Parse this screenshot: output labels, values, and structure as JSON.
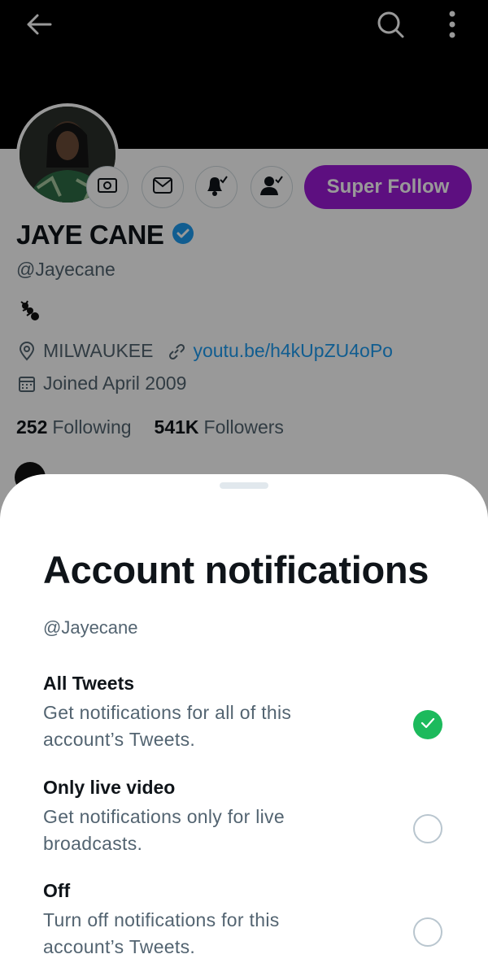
{
  "profile": {
    "super_follow_label": "Super Follow",
    "display_name": "JAYE CANE",
    "handle": "@Jayecane",
    "location": "MILWAUKEE",
    "link": "youtu.be/h4kUpZU4oPo",
    "joined": "Joined April 2009",
    "following_count": "252",
    "following_label": "Following",
    "followers_count": "541K",
    "followers_label": "Followers",
    "icons": [
      "back-arrow-icon",
      "search-icon",
      "more-vertical-icon",
      "tip-jar-icon",
      "envelope-icon",
      "bell-check-icon",
      "person-check-icon",
      "verified-badge-icon",
      "ant-emoji-icon",
      "location-pin-icon",
      "link-icon",
      "calendar-icon"
    ]
  },
  "sheet": {
    "title": "Account notifications",
    "handle": "@Jayecane",
    "options": [
      {
        "title": "All Tweets",
        "description": "Get notifications for all of this account’s Tweets.",
        "selected": true
      },
      {
        "title": "Only live video",
        "description": "Get notifications only for live broadcasts.",
        "selected": false
      },
      {
        "title": "Off",
        "description": "Turn off notifications for this account’s Tweets.",
        "selected": false
      }
    ]
  },
  "colors": {
    "accent": "#1d9bf0",
    "super_follow": "#9b1ad6",
    "selected_check": "#1cba5c",
    "secondary_text": "#536471"
  }
}
